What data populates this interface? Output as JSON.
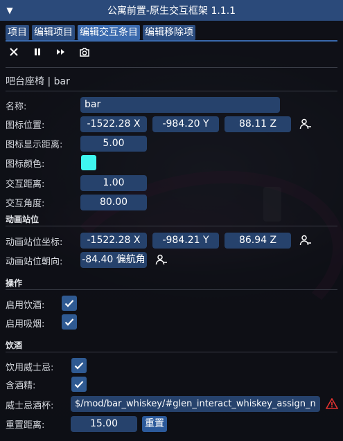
{
  "window": {
    "title": "公寓前置-原生交互框架 1.1.1",
    "collapse_glyph": "▼"
  },
  "tabs": [
    "项目",
    "编辑项目",
    "编辑交互条目",
    "编辑移除项"
  ],
  "toolbar": {
    "icons": [
      "close-icon",
      "pause-icon",
      "fast-forward-icon",
      "camera-reload-icon"
    ]
  },
  "item_header": "吧台座椅 | bar",
  "basic": {
    "name_label": "名称:",
    "name_value": "bar",
    "icon_pos_label": "图标位置:",
    "icon_pos": [
      "-1522.28 X",
      "-984.20 Y",
      "88.11 Z"
    ],
    "icon_dist_label": "图标显示距离:",
    "icon_dist_value": "5.00",
    "icon_color_label": "图标颜色:",
    "icon_color": "#3ff6f0",
    "interact_dist_label": "交互距离:",
    "interact_dist_value": "1.00",
    "interact_angle_label": "交互角度:",
    "interact_angle_value": "80.00"
  },
  "anim": {
    "section": "动画站位",
    "pos_label": "动画站位坐标:",
    "pos": [
      "-1522.28 X",
      "-984.21 Y",
      "86.94 Z"
    ],
    "heading_label": "动画站位朝向:",
    "heading_value": "-84.40 偏航角"
  },
  "ops": {
    "section": "操作",
    "drink_label": "启用饮酒:",
    "smoke_label": "启用吸烟:"
  },
  "drink": {
    "section": "饮酒",
    "whiskey_label": "饮用威士忌:",
    "alcohol_label": "含酒精:",
    "glass_label": "威士忌酒杯:",
    "glass_value": "$/mod/bar_whiskey/#glen_interact_whiskey_assign_n",
    "reset_dist_label": "重置距离:",
    "reset_dist_value": "15.00",
    "reset_button": "重置"
  },
  "colors": {
    "accent": "#2b4a7a",
    "field": "#26426c",
    "warning": "#e0322f"
  }
}
